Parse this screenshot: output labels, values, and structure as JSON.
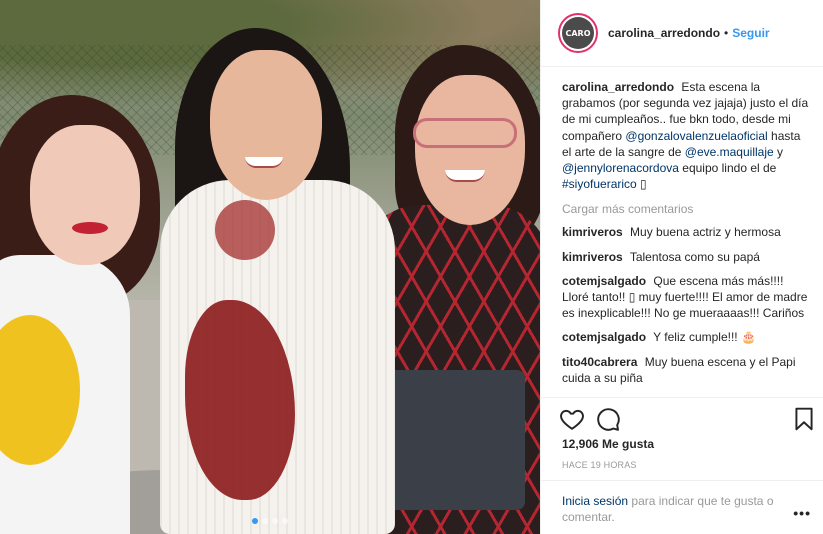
{
  "header": {
    "avatar_text": "CARO",
    "username": "carolina_arredondo",
    "separator": "•",
    "follow_label": "Seguir"
  },
  "caption": {
    "username": "carolina_arredondo",
    "text_1": "Esta escena la grabamos (por segunda vez jajaja) justo el día de mi cumpleaños.. fue bkn todo, desde mi compañero",
    "mention_1": "@gonzalovalenzuelaoficial",
    "text_2": "hasta el arte de la sangre de",
    "mention_2": "@eve.maquillaje",
    "text_3": "y",
    "mention_3": "@jennylorenacordova",
    "text_4": "equipo lindo el de",
    "hashtag": "#siyofuerarico",
    "text_5": "▯"
  },
  "load_more_label": "Cargar más comentarios",
  "comments": [
    {
      "user": "kimriveros",
      "text": "Muy buena actriz y hermosa"
    },
    {
      "user": "kimriveros",
      "text": "Talentosa como su papá"
    },
    {
      "user": "cotemjsalgado",
      "text": "Que escena más más!!!! Lloré tanto!! ▯ muy fuerte!!!! El amor de madre es inexplicable!!! No ge mueraaaas!!! Cariños"
    },
    {
      "user": "cotemjsalgado",
      "text": "Y feliz cumple!!! 🎂"
    },
    {
      "user": "tito40cabrera",
      "text": "Muy buena escena y el Papi cuida a su piña"
    }
  ],
  "actions": {
    "like_icon": "heart-icon",
    "comment_icon": "comment-icon",
    "save_icon": "bookmark-icon"
  },
  "likes_label": "12,906 Me gusta",
  "time_ago": "HACE 19 HORAS",
  "login": {
    "link": "Inicia sesión",
    "rest": "para indicar que te gusta o comentar."
  },
  "more_label": "•••",
  "carousel": {
    "count": 4,
    "active_index": 0
  },
  "colors": {
    "accent": "#3897f0",
    "mention": "#003569",
    "muted": "#999999"
  }
}
